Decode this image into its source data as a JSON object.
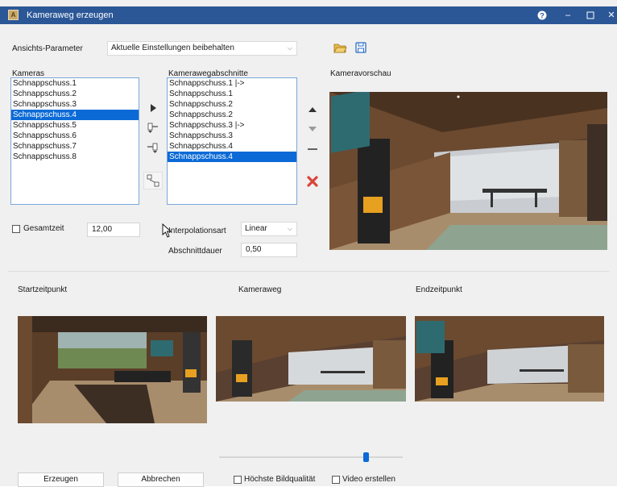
{
  "window": {
    "title": "Kameraweg erzeugen",
    "help_icon": "help-icon",
    "minimize_icon": "minimize-icon",
    "maximize_icon": "maximize-icon",
    "close_icon": "close-icon"
  },
  "view_params": {
    "label": "Ansichts-Parameter",
    "selected": "Aktuelle Einstellungen beibehalten"
  },
  "cameras": {
    "label": "Kameras",
    "items": [
      "Schnappschuss.1",
      "Schnappschuss.2",
      "Schnappschuss.3",
      "Schnappschuss.4",
      "Schnappschuss.5",
      "Schnappschuss.6",
      "Schnappschuss.7",
      "Schnappschuss.8"
    ],
    "selected_index": 3
  },
  "segments": {
    "label": "Kamerawegabschnitte",
    "items": [
      "Schnappschuss.1  |->",
      "Schnappschuss.1",
      "Schnappschuss.2",
      "Schnappschuss.2",
      "Schnappschuss.3  |->",
      "Schnappschuss.3",
      "Schnappschuss.4",
      "Schnappschuss.4"
    ],
    "selected_index": 7
  },
  "preview": {
    "label": "Kameravorschau"
  },
  "total_time": {
    "label": "Gesamtzeit",
    "value": "12,00",
    "checked": false
  },
  "interpolation": {
    "label": "Interpolationsart",
    "selected": "Linear"
  },
  "segment_duration": {
    "label": "Abschnittdauer",
    "value": "0,50"
  },
  "timeline": {
    "start_label": "Startzeitpunkt",
    "path_label": "Kameraweg",
    "end_label": "Endzeitpunkt",
    "slider_position": 0.81
  },
  "footer": {
    "generate": "Erzeugen",
    "cancel": "Abbrechen",
    "best_quality": "Höchste Bildqualität",
    "create_video": "Video erstellen"
  },
  "colors": {
    "titlebar": "#2b5797",
    "selection": "#0b6ad6",
    "delete": "#d9443a",
    "slider": "#0b6ad6"
  }
}
